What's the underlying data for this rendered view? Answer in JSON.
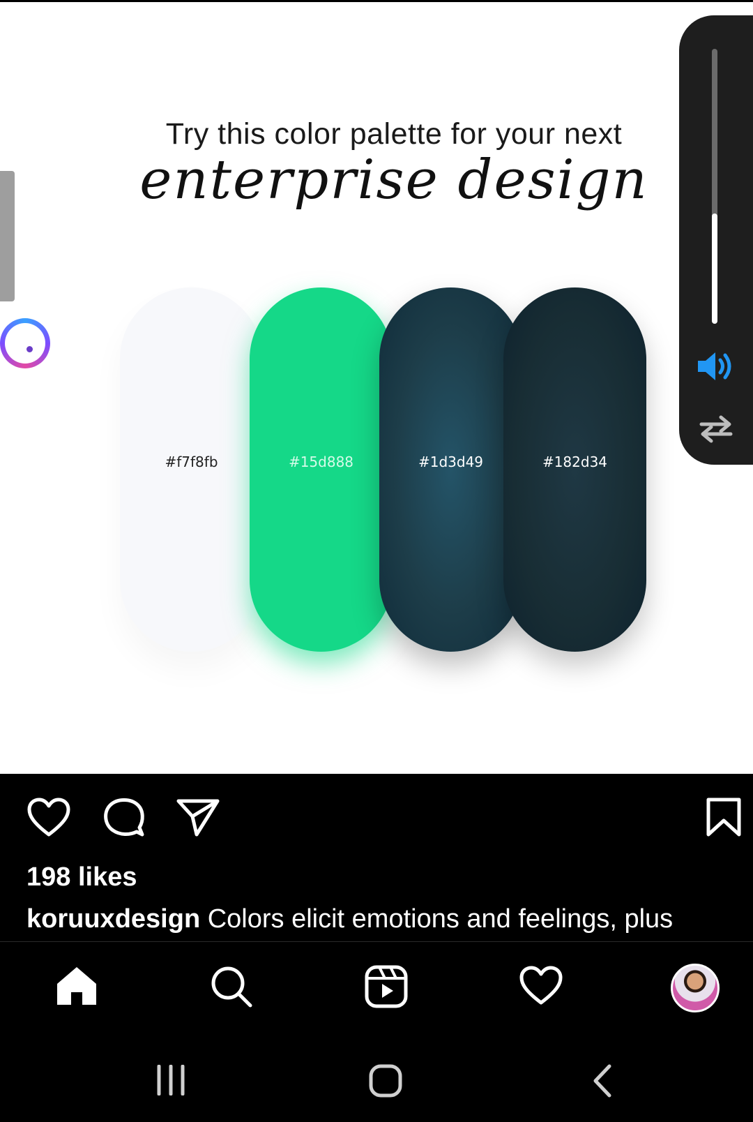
{
  "post": {
    "headline": "Try this color palette for your next",
    "script_title": "enterprise design",
    "palette": [
      {
        "hex_label": "#f7f8fb",
        "color": "#f7f8fb",
        "text_color": "#222222"
      },
      {
        "hex_label": "#15d888",
        "color": "#15d888",
        "text_color": "#d6fbe9"
      },
      {
        "hex_label": "#1d3d49",
        "color": "#1d3d49",
        "text_color": "#ffffff"
      },
      {
        "hex_label": "#182d34",
        "color": "#182d34",
        "text_color": "#ffffff"
      }
    ]
  },
  "volume_panel": {
    "level_fraction": 0.4,
    "volume_icon": "speaker-volume-icon",
    "swap_icon": "swap-arrows-icon",
    "accent": "#2196f3"
  },
  "post_actions": {
    "icons": [
      "heart-icon",
      "comment-icon",
      "share-icon",
      "bookmark-icon"
    ],
    "likes_text": "198 likes",
    "caption_user": "koruuxdesign",
    "caption_text": "Colors elicit emotions and feelings, plus"
  },
  "bottom_nav": {
    "icons": [
      "home-icon",
      "search-icon",
      "reels-icon",
      "activity-heart-icon",
      "profile-avatar"
    ]
  },
  "system_nav": {
    "icons": [
      "recent-apps-icon",
      "home-button-icon",
      "back-icon"
    ]
  }
}
